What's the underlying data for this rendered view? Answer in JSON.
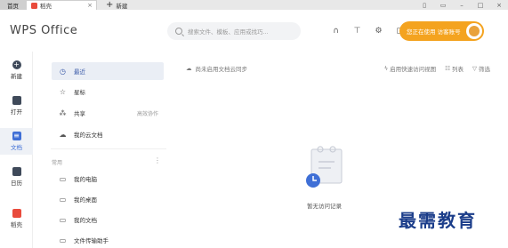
{
  "tabs": {
    "home_label": "首页",
    "doc_label": "稻壳",
    "new_tab_label": "新建"
  },
  "header": {
    "brand": "WPS Office",
    "search_placeholder": "搜索文件、模板、应用或找巧...",
    "account_label": "您正在使用 访客账号"
  },
  "rail": {
    "items": [
      {
        "label": "新建",
        "icon": "plus-icon"
      },
      {
        "label": "打开",
        "icon": "folder-icon"
      },
      {
        "label": "文档",
        "icon": "document-icon"
      },
      {
        "label": "日历",
        "icon": "calendar-icon"
      },
      {
        "label": "稻壳",
        "icon": "docer-icon"
      }
    ]
  },
  "sidebar": {
    "items": [
      {
        "label": "最近",
        "icon": "clock-icon"
      },
      {
        "label": "星标",
        "icon": "star-icon"
      },
      {
        "label": "共享",
        "icon": "share-icon",
        "extra": "高效协作"
      },
      {
        "label": "我的云文档",
        "icon": "cloud-icon"
      }
    ],
    "section_label": "常用",
    "common_items": [
      {
        "label": "我的电脑",
        "icon": "computer-icon"
      },
      {
        "label": "我的桌面",
        "icon": "desktop-icon"
      },
      {
        "label": "我的文档",
        "icon": "folder-doc-icon"
      },
      {
        "label": "文件传输助手",
        "icon": "transfer-icon"
      }
    ]
  },
  "main": {
    "cloud_note": "尚未启用文档云同步",
    "quick_access": "启用快速访问视图",
    "list_label": "列表",
    "filter_label": "筛选",
    "empty_text": "暂无访问记录"
  },
  "watermark": "最需教育"
}
